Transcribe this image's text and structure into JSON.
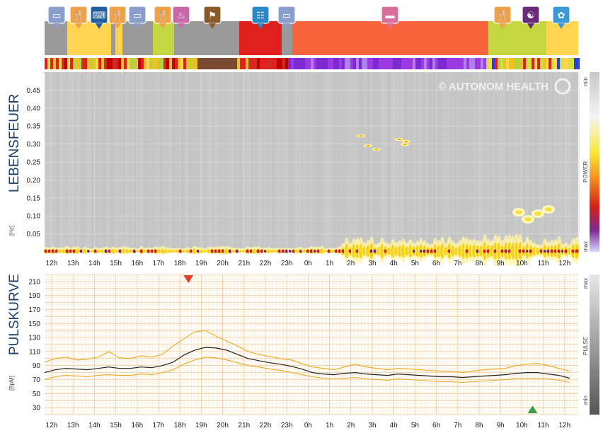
{
  "brand": "© AUTONOM HEALTH",
  "panels": {
    "hrv": {
      "title": "LEBENSFEUER",
      "unit": "[Hz]",
      "legend_title": "POWER",
      "legend_min": "min",
      "legend_max": "max"
    },
    "pulse": {
      "title": "PULSKURVE",
      "unit": "[BpM]",
      "legend_title": "PULSE",
      "legend_min": "min",
      "legend_max": "max"
    }
  },
  "activity_icons": [
    {
      "name": "screen",
      "color": "#8a9ecb"
    },
    {
      "name": "meal",
      "color": "#f0a24a"
    },
    {
      "name": "work",
      "color": "#1f5fa0"
    },
    {
      "name": "meal",
      "color": "#f0a24a"
    },
    {
      "name": "screen",
      "color": "#8a9ecb"
    },
    {
      "name": "meal",
      "color": "#f0a24a"
    },
    {
      "name": "bath",
      "color": "#c86aa8"
    },
    {
      "name": "walk",
      "color": "#8b5a2b"
    },
    {
      "name": "meeting",
      "color": "#2a88c8"
    },
    {
      "name": "screen",
      "color": "#8a9ecb"
    },
    {
      "name": "sleep",
      "color": "#d8709a"
    },
    {
      "name": "meal",
      "color": "#f0a24a"
    },
    {
      "name": "relax",
      "color": "#6a2a7a"
    },
    {
      "name": "mind",
      "color": "#3a9ad8"
    }
  ],
  "chart_data": [
    {
      "type": "heatmap",
      "title": "LEBENSFEUER",
      "ylabel": "[Hz]",
      "x_ticks": [
        "12h",
        "13h",
        "14h",
        "15h",
        "16h",
        "17h",
        "18h",
        "19h",
        "20h",
        "21h",
        "22h",
        "23h",
        "0h",
        "1h",
        "2h",
        "3h",
        "4h",
        "5h",
        "6h",
        "7h",
        "8h",
        "9h",
        "10h",
        "11h",
        "12h"
      ],
      "y_ticks": [
        0.05,
        0.1,
        0.15,
        0.2,
        0.25,
        0.3,
        0.35,
        0.4,
        0.45
      ],
      "ylim": [
        0,
        0.5
      ],
      "color_scale": [
        "#d8d8ff",
        "#6a40c0",
        "#d83020",
        "#f7e83a",
        "#ffffff",
        "#c8c8c8"
      ]
    },
    {
      "type": "line",
      "title": "PULSKURVE",
      "ylabel": "[BpM]",
      "x_ticks": [
        "12h",
        "13h",
        "14h",
        "15h",
        "16h",
        "17h",
        "18h",
        "19h",
        "20h",
        "21h",
        "22h",
        "23h",
        "0h",
        "1h",
        "2h",
        "3h",
        "4h",
        "5h",
        "6h",
        "7h",
        "8h",
        "9h",
        "10h",
        "11h",
        "12h"
      ],
      "y_ticks": [
        30,
        50,
        70,
        90,
        110,
        130,
        150,
        170,
        190,
        210
      ],
      "ylim": [
        20,
        220
      ],
      "x_hours": [
        0,
        0.5,
        1,
        1.5,
        2,
        2.5,
        3,
        3.5,
        4,
        4.5,
        5,
        5.5,
        6,
        6.5,
        7,
        7.5,
        8,
        8.5,
        9,
        9.5,
        10,
        10.5,
        11,
        11.5,
        12,
        12.5,
        13,
        13.5,
        14,
        14.5,
        15,
        15.5,
        16,
        16.5,
        17,
        17.5,
        18,
        18.5,
        19,
        19.5,
        20,
        20.5,
        21,
        21.5,
        22,
        22.5,
        23,
        23.5,
        24,
        24.5
      ],
      "series": [
        {
          "values": [
            80,
            84,
            86,
            85,
            84,
            86,
            88,
            86,
            86,
            88,
            87,
            90,
            95,
            105,
            112,
            116,
            115,
            112,
            106,
            100,
            97,
            94,
            92,
            89,
            85,
            80,
            78,
            77,
            79,
            80,
            78,
            77,
            76,
            78,
            77,
            76,
            75,
            74,
            74,
            73,
            74,
            75,
            76,
            77,
            79,
            80,
            80,
            78,
            76,
            72
          ]
        },
        {
          "values": [
            95,
            100,
            102,
            98,
            99,
            102,
            110,
            101,
            100,
            104,
            102,
            106,
            118,
            128,
            138,
            140,
            132,
            125,
            118,
            110,
            106,
            103,
            100,
            98,
            93,
            88,
            86,
            84,
            88,
            92,
            88,
            86,
            84,
            86,
            85,
            84,
            83,
            82,
            82,
            80,
            82,
            84,
            85,
            86,
            90,
            92,
            93,
            90,
            86,
            82
          ]
        },
        {
          "values": [
            70,
            74,
            76,
            75,
            74,
            76,
            77,
            76,
            76,
            78,
            77,
            80,
            84,
            92,
            98,
            102,
            101,
            98,
            94,
            90,
            88,
            85,
            83,
            80,
            77,
            74,
            72,
            71,
            72,
            73,
            71,
            70,
            69,
            71,
            70,
            69,
            68,
            67,
            67,
            66,
            67,
            68,
            69,
            70,
            71,
            72,
            72,
            71,
            69,
            66
          ]
        }
      ],
      "markers": [
        {
          "label": "max",
          "hour": 6.4,
          "value": 214,
          "color": "#e0402a"
        },
        {
          "label": "min",
          "hour": 22.5,
          "value": 27,
          "color": "#3aa04a"
        }
      ]
    }
  ]
}
